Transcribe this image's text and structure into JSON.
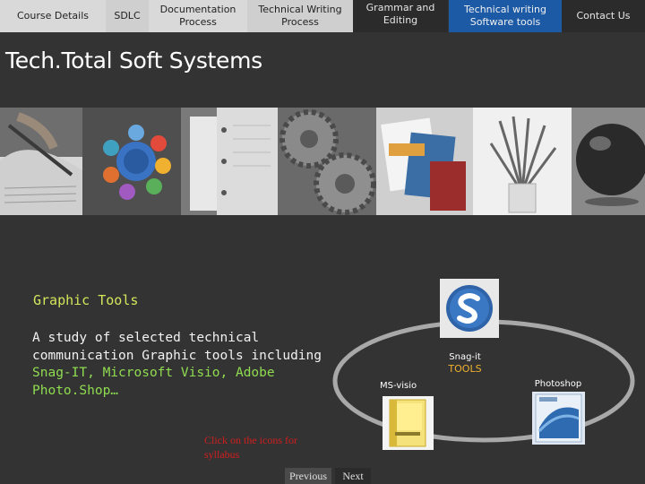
{
  "nav": {
    "tabs": [
      {
        "label": "Course Details"
      },
      {
        "label": "SDLC"
      },
      {
        "label": "Documentation Process"
      },
      {
        "label": "Technical Writing Process"
      },
      {
        "label": "Grammar and Editing"
      },
      {
        "label": "Technical writing Software tools"
      },
      {
        "label": "Contact Us"
      }
    ]
  },
  "site": {
    "title": "Tech.Total Soft Systems"
  },
  "photos": [
    "pen-and-paper",
    "process-diagram",
    "binder",
    "gears",
    "gears",
    "brochures",
    "pencils",
    "glass-sphere"
  ],
  "content": {
    "section_title": "Graphic Tools",
    "desc_text": "A study of selected technical communication Graphic tools including ",
    "desc_tools": "Snag-IT, Microsoft Visio, Adobe Photo.Shop…",
    "click_note": "Click on the icons for syllabus"
  },
  "tools": {
    "snagit_label": "Snag-it",
    "snagit_sub": "TOOLS",
    "visio_label": "MS-visio",
    "photoshop_label": "Photoshop"
  },
  "pager": {
    "previous": "Previous",
    "next": "Next"
  },
  "colors": {
    "background": "#333333",
    "active_tab": "#1c5aa6",
    "heading": "#d4e65a",
    "highlight": "#8fdc50",
    "note": "#d11e1e"
  }
}
